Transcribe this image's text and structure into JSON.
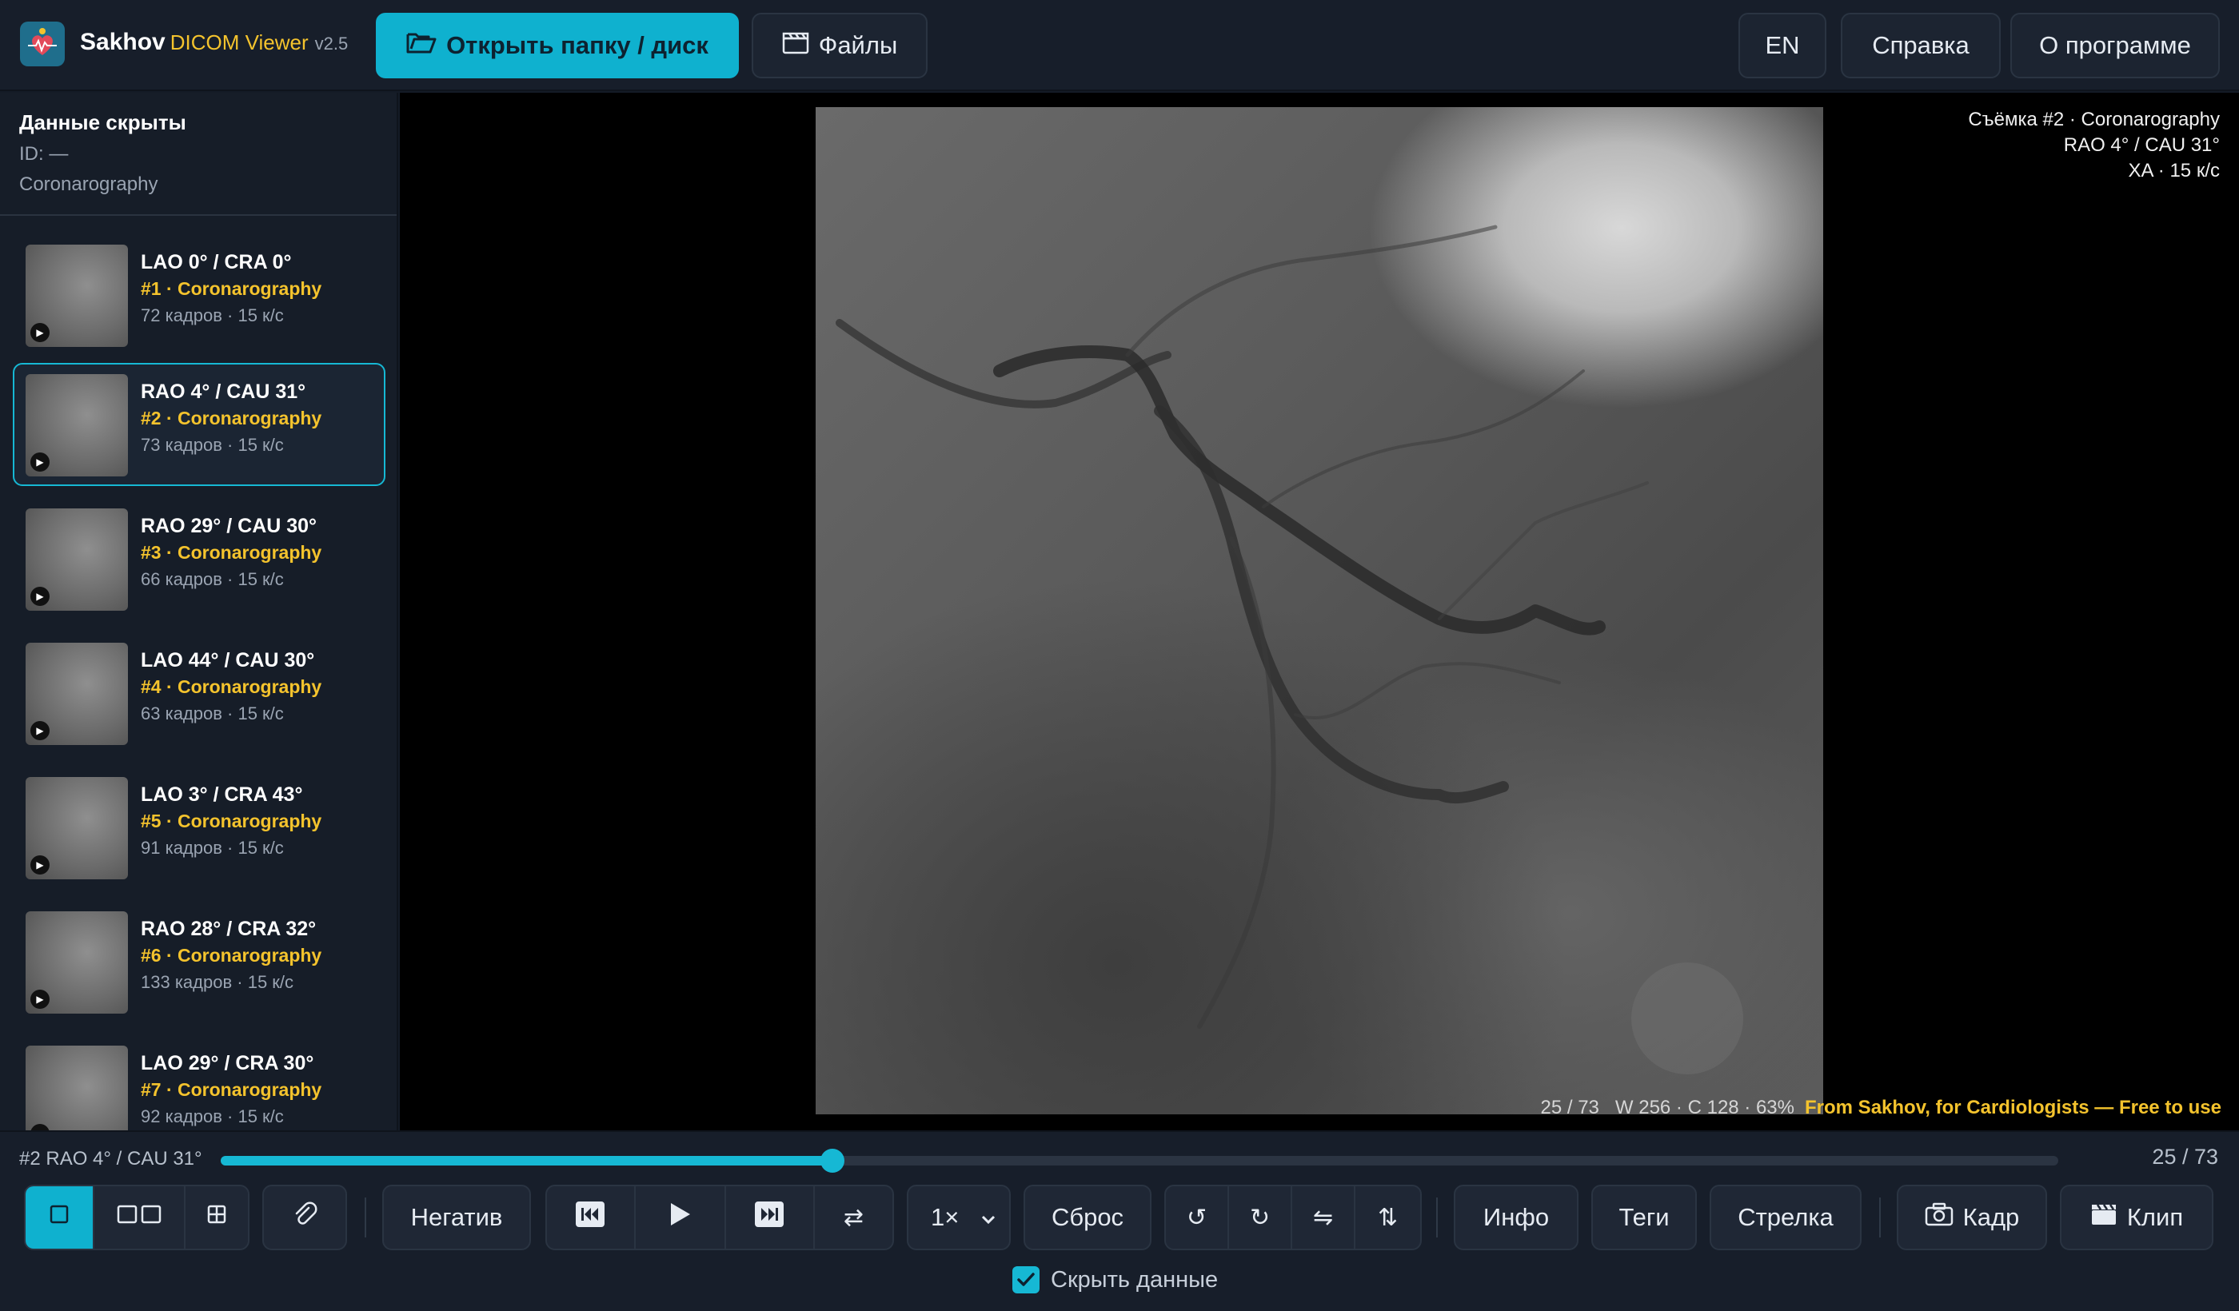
{
  "app": {
    "name": "Sakhov",
    "subtitle": "DICOM Viewer",
    "version": "v2.5"
  },
  "header": {
    "open_label": "Открыть папку / диск",
    "files_label": "Файлы",
    "lang_label": "EN",
    "help_label": "Справка",
    "about_label": "О программе"
  },
  "patient": {
    "name": "Данные скрыты",
    "id": "ID: —",
    "study": "Coronarography"
  },
  "series": [
    {
      "title": "LAO 0° / CRA 0°",
      "sub": "#1 · Coronarography",
      "info": "72 кадров · 15 к/с"
    },
    {
      "title": "RAO 4° / CAU 31°",
      "sub": "#2 · Coronarography",
      "info": "73 кадров · 15 к/с"
    },
    {
      "title": "RAO 29° / CAU 30°",
      "sub": "#3 · Coronarography",
      "info": "66 кадров · 15 к/с"
    },
    {
      "title": "LAO 44° / CAU 30°",
      "sub": "#4 · Coronarography",
      "info": "63 кадров · 15 к/с"
    },
    {
      "title": "LAO 3° / CRA 43°",
      "sub": "#5 · Coronarography",
      "info": "91 кадров · 15 к/с"
    },
    {
      "title": "RAO 28° / CRA 32°",
      "sub": "#6 · Coronarography",
      "info": "133 кадров · 15 к/с"
    },
    {
      "title": "LAO 29° / CRA 30°",
      "sub": "#7 · Coronarography",
      "info": "92 кадров · 15 к/с"
    }
  ],
  "viewer": {
    "overlay_line1": "Съёмка #2 · Coronarography",
    "overlay_line2": "RAO 4° / CAU 31°",
    "overlay_line3": "XA · 15 к/с",
    "stats": "25 / 73   W 256 · C 128 · 63%",
    "credit": "From Sakhov, for Cardiologists — Free to use"
  },
  "scrubber": {
    "label": "#2 RAO 4° / CAU 31°",
    "count": "25 / 73",
    "progress": 0.333
  },
  "toolbar": {
    "negative_label": "Негатив",
    "speed_value": "1×",
    "reset_label": "Сброс",
    "info_label": "Инфо",
    "tags_label": "Теги",
    "arrow_label": "Стрелка",
    "frame_label": "Кадр",
    "clip_label": "Клип",
    "hide_data_label": "Скрыть данные"
  },
  "colors": {
    "accent": "#0fb1cf",
    "highlight": "#f4c32d",
    "background": "#141b26"
  }
}
